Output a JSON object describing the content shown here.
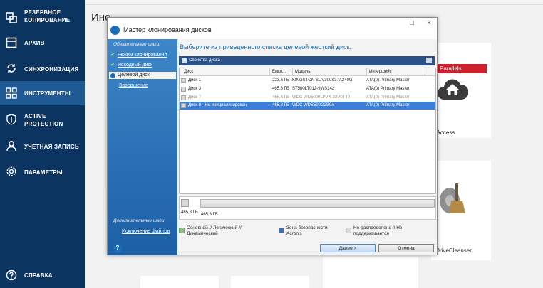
{
  "sidebar": {
    "items": [
      {
        "label": "РЕЗЕРВНОЕ КОПИРОВАНИЕ",
        "icon": "copy-icon"
      },
      {
        "label": "АРХИВ",
        "icon": "archive-icon"
      },
      {
        "label": "СИНХРОНИЗАЦИЯ",
        "icon": "sync-icon"
      },
      {
        "label": "ИНСТРУМЕНТЫ",
        "icon": "grid-icon"
      },
      {
        "label": "ACTIVE PROTECTION",
        "icon": "shield-icon"
      },
      {
        "label": "УЧЕТНАЯ ЗАПИСЬ",
        "icon": "user-icon"
      },
      {
        "label": "ПАРАМЕТРЫ",
        "icon": "gear-icon"
      },
      {
        "label": "СПРАВКА",
        "icon": "help-icon"
      }
    ],
    "active_index": 3,
    "colors": {
      "background": "#0b3461",
      "active": "#1f5a94"
    }
  },
  "main": {
    "title": "Инс",
    "cards": {
      "parallels_badge": "Parallels",
      "access_label": "ls Access",
      "drivecleanser_label": "s DriveCleanser"
    }
  },
  "dialog": {
    "title": "Мастер клонирования дисков",
    "window_buttons": {
      "maximize": "☐",
      "close": "✕"
    },
    "left_panel": {
      "required_steps_header": "Обязательные шаги:",
      "steps": [
        {
          "label": "Режим клонирования",
          "state": "done"
        },
        {
          "label": "Исходный диск",
          "state": "done"
        },
        {
          "label": "Целевой диск",
          "state": "current"
        },
        {
          "label": "Завершение",
          "state": "pending"
        }
      ],
      "optional_steps_header": "Дополнительные шаги:",
      "optional_steps": [
        {
          "label": "Исключение файлов"
        }
      ]
    },
    "instruction": "Выберите из приведенного списка целевой жесткий диск.",
    "properties_label": "Свойства диска",
    "table": {
      "columns": [
        "Диск",
        "Емко...",
        "Модель",
        "Интерфейс"
      ],
      "rows": [
        {
          "disk": "Диск 1",
          "capacity": "223,6 ГБ",
          "model": "KINGSTON SUV300S37A240G",
          "interface": "ATA(0) Primary Master",
          "state": "normal"
        },
        {
          "disk": "Диск 3",
          "capacity": "465,8 ГБ",
          "model": "ST500LT012-9WS142",
          "interface": "ATA(0) Primary Master",
          "state": "normal"
        },
        {
          "disk": "Диск 7",
          "capacity": "465,8 ГБ",
          "model": "WDC WD5000LPVX-22V0TT0",
          "interface": "ATA(0) Primary Master",
          "state": "disabled"
        },
        {
          "disk": "Диск 8 - Не инициализирован",
          "capacity": "465,8 ГБ",
          "model": "WDC WDS500G2B0A",
          "interface": "ATA(0) Primary Master",
          "state": "selected"
        }
      ]
    },
    "disk_bar": {
      "total": "465,8 ГБ",
      "size": "465,8 ГБ"
    },
    "legend": [
      {
        "label": "Основной // Логический // Динамический",
        "color": "#7bc96f"
      },
      {
        "label": "Зона безопасности Acronis",
        "color": "#3a6fc4"
      },
      {
        "label": "Не распределено // Не поддерживается",
        "color": "#d9d9d9"
      }
    ],
    "buttons": {
      "next": "Далее >",
      "cancel": "Отмена"
    }
  }
}
